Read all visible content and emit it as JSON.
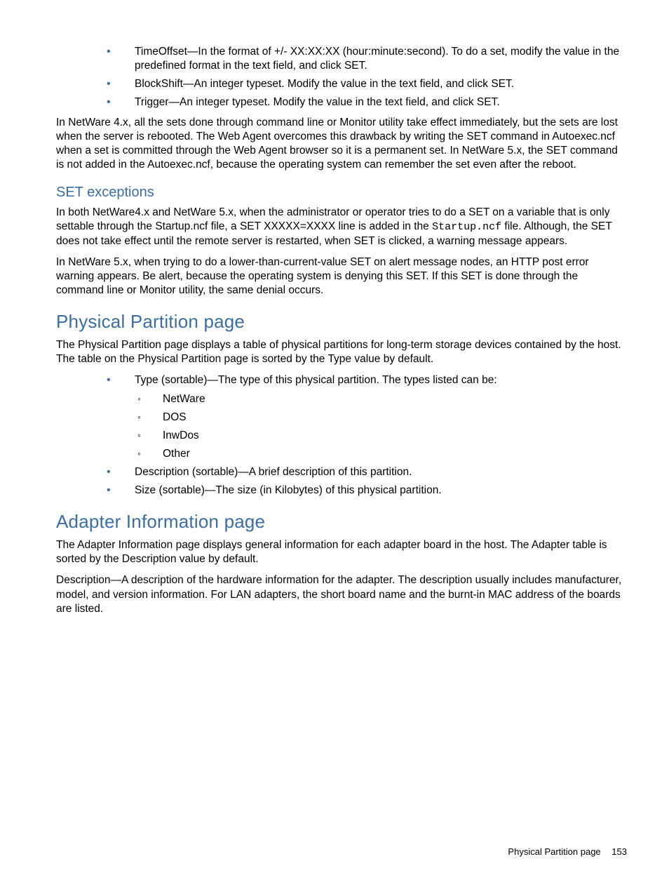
{
  "top_bullets": [
    "TimeOffset—In the format of +/- XX:XX:XX (hour:minute:second). To do a set, modify the value in the predefined format in the text field, and click SET.",
    "BlockShift—An integer typeset. Modify the value in the text field, and click SET.",
    "Trigger—An integer typeset. Modify the value in the text field, and click SET."
  ],
  "top_paragraph": "In NetWare 4.x, all the sets done through command line or Monitor utility take effect immediately, but the sets are lost when the server is rebooted. The Web Agent overcomes this drawback by writing the SET command in Autoexec.ncf when a set is committed through the Web Agent browser so it is a permanent set. In NetWare 5.x, the SET command is not added in the Autoexec.ncf, because the operating system can remember the set even after the reboot.",
  "set_exceptions": {
    "heading": "SET exceptions",
    "p1_a": "In both NetWare4.x and NetWare 5.x, when the administrator or operator tries to do a SET on a variable that is only settable through the Startup.ncf file, a SET XXXXX=XXXX line is added in the ",
    "p1_mono": "Startup.ncf",
    "p1_b": " file. Although, the SET does not take effect until the remote server is restarted, when SET is clicked, a warning message appears.",
    "p2": "In NetWare 5.x, when trying to do a lower-than-current-value SET on alert message nodes, an HTTP post error warning appears. Be alert, because the operating system is denying this SET. If this SET is done through the command line or Monitor utility, the same denial occurs."
  },
  "physical_partition": {
    "heading": "Physical Partition page",
    "intro": "The Physical Partition page displays a table of physical partitions for long-term storage devices contained by the host. The table on the Physical Partition page is sorted by the Type value by default.",
    "b1": "Type (sortable)—The type of this physical partition. The types listed can be:",
    "types": [
      "NetWare",
      "DOS",
      "InwDos",
      "Other"
    ],
    "b2": "Description (sortable)—A brief description of this partition.",
    "b3": "Size (sortable)—The size (in Kilobytes) of this physical partition."
  },
  "adapter_info": {
    "heading": "Adapter Information page",
    "p1": "The Adapter Information page displays general information for each adapter board in the host. The Adapter table is sorted by the Description value by default.",
    "p2": "Description—A description of the hardware information for the adapter. The description usually includes manufacturer, model, and version information. For LAN adapters, the short board name and the burnt-in MAC address of the boards are listed."
  },
  "footer": {
    "title": "Physical Partition page",
    "page": "153"
  }
}
